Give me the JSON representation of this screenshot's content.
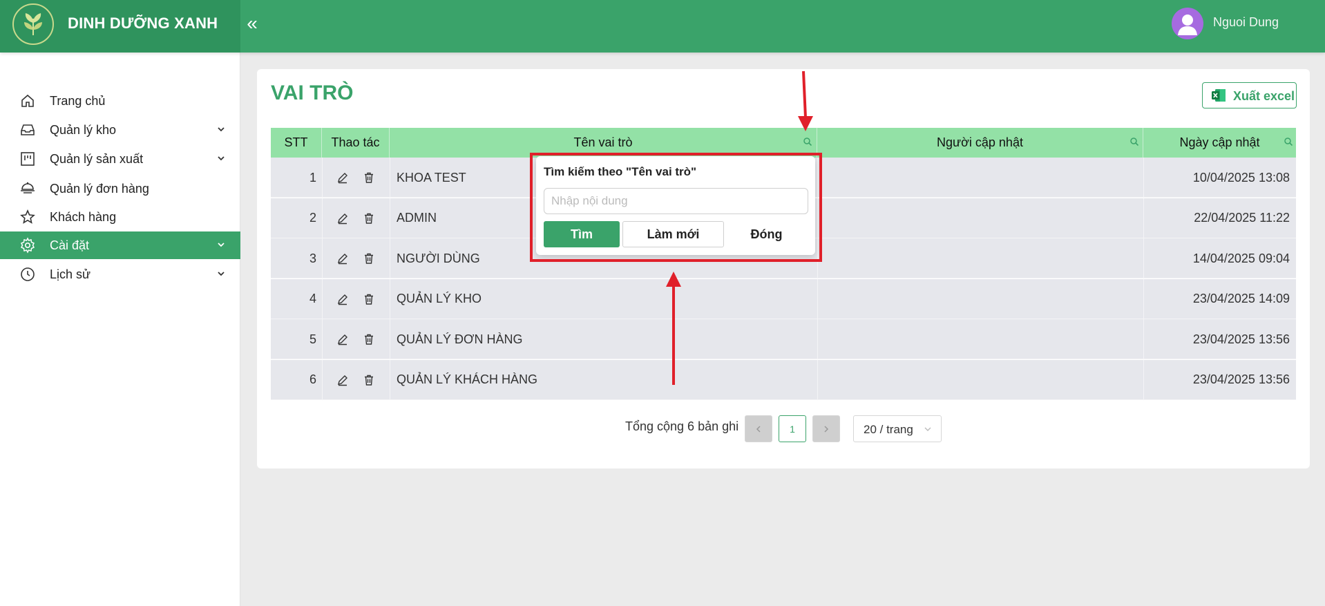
{
  "brand": {
    "name": "DINH DƯỠNG XANH"
  },
  "header": {
    "collapse_glyph": "«",
    "user_name": "Nguoi Dung"
  },
  "sidebar": {
    "items": [
      {
        "label": "Trang chủ",
        "icon": "home-icon",
        "has_children": false,
        "active": false
      },
      {
        "label": "Quản lý kho",
        "icon": "inbox-icon",
        "has_children": true,
        "active": false
      },
      {
        "label": "Quản lý sản xuất",
        "icon": "board-icon",
        "has_children": true,
        "active": false
      },
      {
        "label": "Quản lý đơn hàng",
        "icon": "food-cover-icon",
        "has_children": false,
        "active": false
      },
      {
        "label": "Khách hàng",
        "icon": "star-icon",
        "has_children": false,
        "active": false
      },
      {
        "label": "Cài đặt",
        "icon": "gear-icon",
        "has_children": true,
        "active": true
      },
      {
        "label": "Lịch sử",
        "icon": "clock-icon",
        "has_children": true,
        "active": false
      }
    ]
  },
  "page": {
    "title": "VAI TRÒ",
    "export_label": "Xuất excel"
  },
  "table": {
    "headers": {
      "stt": "STT",
      "actions": "Thao tác",
      "role_name": "Tên vai trò",
      "updated_by": "Người cập nhật",
      "updated_at": "Ngày cập nhật"
    },
    "rows": [
      {
        "stt": "1",
        "role_name": "KHOA TEST",
        "updated_by": "",
        "updated_at": "10/04/2025 13:08"
      },
      {
        "stt": "2",
        "role_name": "ADMIN",
        "updated_by": "",
        "updated_at": "22/04/2025 11:22"
      },
      {
        "stt": "3",
        "role_name": "NGƯỜI DÙNG",
        "updated_by": "",
        "updated_at": "14/04/2025 09:04"
      },
      {
        "stt": "4",
        "role_name": "QUẢN LÝ KHO",
        "updated_by": "",
        "updated_at": "23/04/2025 14:09"
      },
      {
        "stt": "5",
        "role_name": "QUẢN LÝ ĐƠN HÀNG",
        "updated_by": "",
        "updated_at": "23/04/2025 13:56"
      },
      {
        "stt": "6",
        "role_name": "QUẢN LÝ KHÁCH HÀNG",
        "updated_by": "",
        "updated_at": "23/04/2025 13:56"
      }
    ]
  },
  "pagination": {
    "total_text": "Tổng cộng 6 bản ghi",
    "current_page": "1",
    "page_size": "20 / trang"
  },
  "search_popup": {
    "title": "Tìm kiếm theo \"Tên vai trò\"",
    "placeholder": "Nhập nội dung",
    "value": "",
    "find_label": "Tìm",
    "reset_label": "Làm mới",
    "close_label": "Đóng"
  },
  "colors": {
    "primary": "#3aa36a",
    "header_row": "#93e1a6",
    "row_bg": "#e6e7ec",
    "annotation": "#e0202a"
  }
}
